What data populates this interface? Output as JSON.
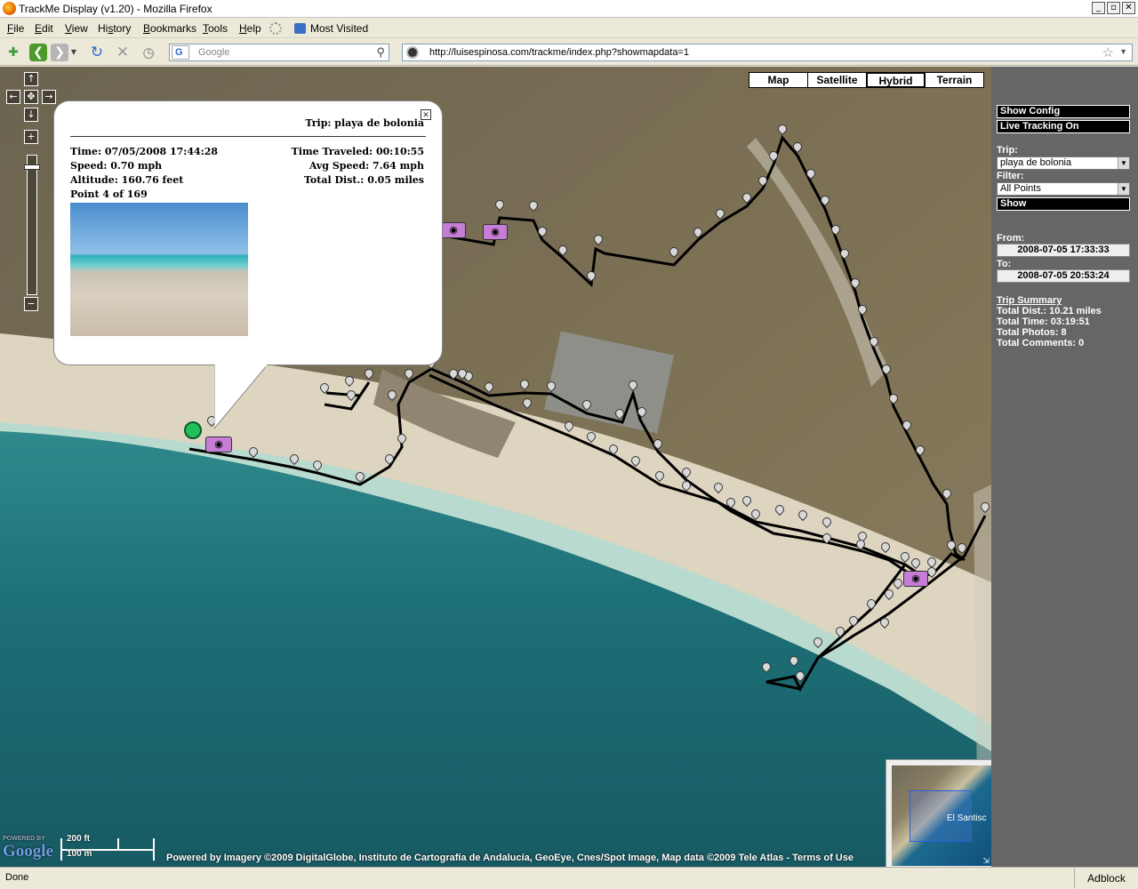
{
  "window": {
    "title": "TrackMe Display (v1.20) - Mozilla Firefox",
    "controls": [
      "_",
      "▫",
      "✕"
    ]
  },
  "menu": {
    "items": [
      {
        "pre": "",
        "u": "F",
        "post": "ile"
      },
      {
        "pre": "",
        "u": "E",
        "post": "dit"
      },
      {
        "pre": "",
        "u": "V",
        "post": "iew"
      },
      {
        "pre": "Hi",
        "u": "s",
        "post": "tory"
      },
      {
        "pre": "",
        "u": "B",
        "post": "ookmarks"
      },
      {
        "pre": "",
        "u": "T",
        "post": "ools"
      },
      {
        "pre": "",
        "u": "H",
        "post": "elp"
      }
    ],
    "most_visited": "Most Visited"
  },
  "nav": {
    "search_placeholder": "Google",
    "url": "http://luisespinosa.com/trackme/index.php?showmapdata=1"
  },
  "map": {
    "types": [
      "Map",
      "Satellite",
      "Hybrid",
      "Terrain"
    ],
    "active_type": "Hybrid",
    "info_window": {
      "trip": "Trip: playa de bolonia",
      "time": "Time: 07/05/2008 17:44:28",
      "speed": "Speed: 0.70 mph",
      "altitude": "Altitude: 160.76 feet",
      "point": "Point 4 of 169",
      "time_traveled": "Time Traveled: 00:10:55",
      "avg_speed": "Avg Speed: 7.64 mph",
      "total_dist": "Total Dist.: 0.05 miles"
    },
    "scale": {
      "ft": "200 ft",
      "m": "100 m"
    },
    "powered_by": "POWERED BY",
    "google": "Google",
    "attribution": "Powered by Imagery ©2009 DigitalGlobe, Instituto de Cartografía de Andalucía, GeoEye, Cnes/Spot Image, Map data ©2009 Tele Atlas - Terms of Use",
    "overview_label": "El Santisc"
  },
  "sidebar": {
    "show_config": "Show Config",
    "live_tracking": "Live Tracking On",
    "trip_label": "Trip:",
    "trip_value": "playa de bolonia",
    "filter_label": "Filter:",
    "filter_value": "All Points",
    "show": "Show",
    "from_label": "From:",
    "from_value": "2008-07-05 17:33:33",
    "to_label": "To:",
    "to_value": "2008-07-05 20:53:24",
    "summary_title": "Trip Summary",
    "total_dist": "Total Dist.: 10.21 miles",
    "total_time": "Total Time: 03:19:51",
    "total_photos": "Total Photos: 8",
    "total_comments": "Total Comments: 0"
  },
  "status": {
    "text": "Done",
    "adblock": "Adblock"
  }
}
